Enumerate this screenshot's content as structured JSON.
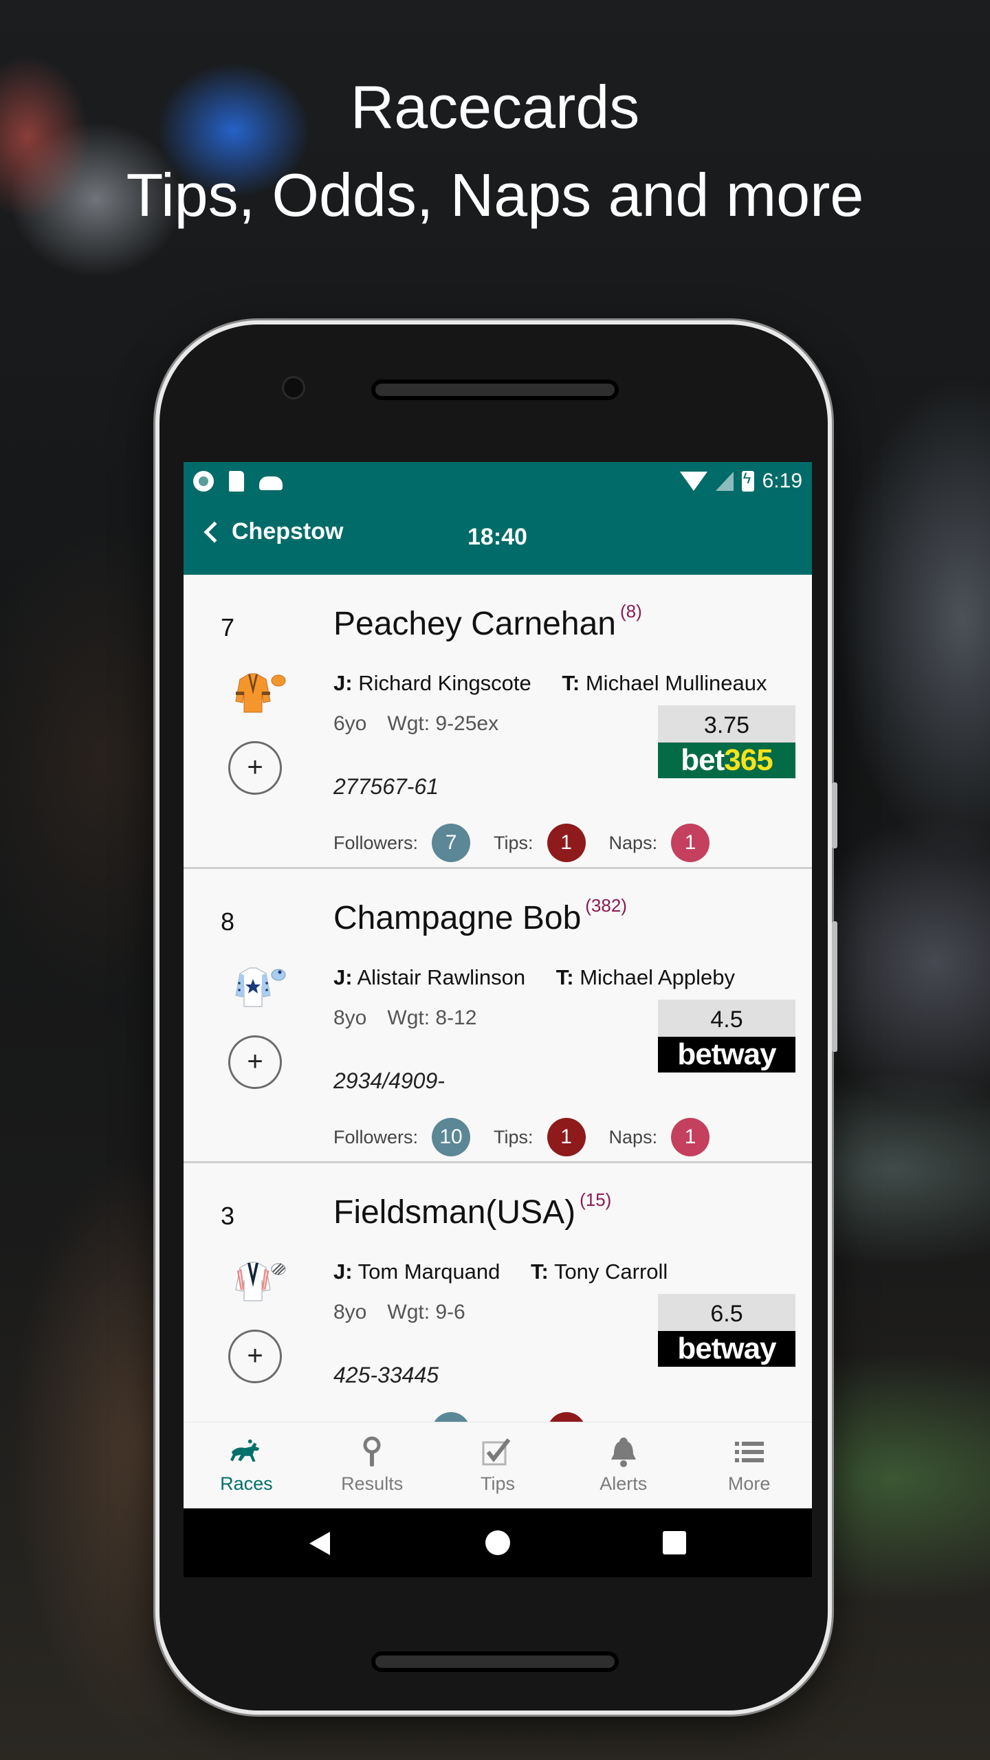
{
  "promo": {
    "title": "Racecards",
    "subtitle": "Tips, Odds, Naps and more"
  },
  "status_bar": {
    "left_icons": [
      "record-icon",
      "sd-card-icon",
      "cloud-icon"
    ],
    "right_icons": [
      "wifi-icon",
      "signal-icon",
      "battery-charging-icon"
    ],
    "time": "6:19"
  },
  "app_bar": {
    "back_label": "Chepstow",
    "race_time": "18:40"
  },
  "runners": [
    {
      "number": "7",
      "name": "Peachey Carnehan",
      "rank": "(8)",
      "jockey_label": "J:",
      "jockey": "Richard Kingscote",
      "trainer_label": "T:",
      "trainer": "Michael Mullineaux",
      "age": "6yo",
      "weight": "Wgt: 9-25ex",
      "form": "277567-61",
      "odds": "3.75",
      "bookmaker": "bet365",
      "followers_label": "Followers:",
      "followers": "7",
      "tips_label": "Tips:",
      "tips": "1",
      "naps_label": "Naps:",
      "naps": "1",
      "silk": "orange-brown-chevron"
    },
    {
      "number": "8",
      "name": "Champagne Bob",
      "rank": "(382)",
      "jockey_label": "J:",
      "jockey": "Alistair Rawlinson",
      "trainer_label": "T:",
      "trainer": "Michael Appleby",
      "age": "8yo",
      "weight": "Wgt: 8-12",
      "form": "2934/4909-",
      "odds": "4.5",
      "bookmaker": "betway",
      "followers_label": "Followers:",
      "followers": "10",
      "tips_label": "Tips:",
      "tips": "1",
      "naps_label": "Naps:",
      "naps": "1",
      "silk": "white-navy-star"
    },
    {
      "number": "3",
      "name": "Fieldsman(USA)",
      "rank": "(15)",
      "jockey_label": "J:",
      "jockey": "Tom Marquand",
      "trainer_label": "T:",
      "trainer": "Tony Carroll",
      "age": "8yo",
      "weight": "Wgt: 9-6",
      "form": "425-33445",
      "odds": "6.5",
      "bookmaker": "betway",
      "silk": "white-navy-chevron-pink-stripes"
    }
  ],
  "colors": {
    "primary": "#006b68",
    "followers_badge": "#5b8796",
    "tips_badge": "#8e1a1c",
    "naps_badge": "#c4405e",
    "rank_text": "#8b1a55",
    "bet365_green": "#046b47",
    "bet365_yellow": "#f7e31b"
  },
  "bottom_nav": {
    "items": [
      {
        "label": "Races",
        "icon": "horse-racing-icon",
        "active": true
      },
      {
        "label": "Results",
        "icon": "results-icon",
        "active": false
      },
      {
        "label": "Tips",
        "icon": "checkbox-icon",
        "active": false
      },
      {
        "label": "Alerts",
        "icon": "bell-icon",
        "active": false
      },
      {
        "label": "More",
        "icon": "list-icon",
        "active": false
      }
    ]
  }
}
